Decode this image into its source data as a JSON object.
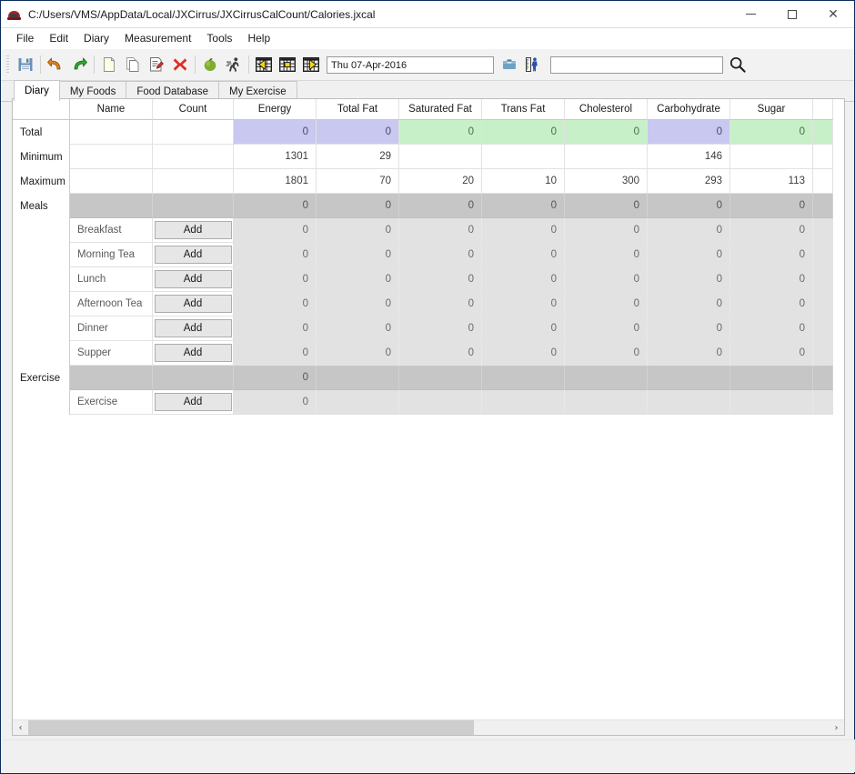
{
  "window": {
    "title": "C:/Users/VMS/AppData/Local/JXCirrus/JXCirrusCalCount/Calories.jxcal",
    "icon": "app-icon",
    "minimize_label": "–",
    "maximize_label": "□",
    "close_label": "✕"
  },
  "menubar": {
    "items": [
      {
        "label": "File"
      },
      {
        "label": "Edit"
      },
      {
        "label": "Diary"
      },
      {
        "label": "Measurement"
      },
      {
        "label": "Tools"
      },
      {
        "label": "Help"
      }
    ]
  },
  "toolbar": {
    "buttons": [
      {
        "name": "save-icon",
        "tip": "Save"
      },
      {
        "name": "undo-icon",
        "tip": "Undo"
      },
      {
        "name": "redo-icon",
        "tip": "Redo"
      },
      {
        "name": "new-document-icon",
        "tip": "New"
      },
      {
        "name": "copy-icon",
        "tip": "Copy"
      },
      {
        "name": "edit-document-icon",
        "tip": "Edit"
      },
      {
        "name": "delete-icon",
        "tip": "Delete"
      },
      {
        "name": "apple-food-icon",
        "tip": "Food"
      },
      {
        "name": "running-person-icon",
        "tip": "Exercise"
      },
      {
        "name": "previous-day-icon",
        "tip": "Previous day"
      },
      {
        "name": "today-icon",
        "tip": "Today"
      },
      {
        "name": "next-day-icon",
        "tip": "Next day"
      }
    ],
    "date_value": "Thu 07-Apr-2016",
    "date_placeholder": "",
    "scale_icon": "weighing-scale-icon",
    "measure_icon": "body-measurement-icon",
    "search_value": "",
    "search_placeholder": "",
    "search_icon": "search-icon"
  },
  "tabs": [
    {
      "label": "Diary",
      "active": true
    },
    {
      "label": "My Foods",
      "active": false
    },
    {
      "label": "Food Database",
      "active": false
    },
    {
      "label": "My Exercise",
      "active": false
    }
  ],
  "grid": {
    "group_header": "",
    "columns": [
      "Name",
      "Count",
      "Energy",
      "Total Fat",
      "Saturated Fat",
      "Trans Fat",
      "Cholesterol",
      "Carbohydrate",
      "Sugar"
    ],
    "rows": [
      {
        "group": "Total",
        "kind": "total",
        "name": "",
        "count": "",
        "values": [
          "0",
          "0",
          "0",
          "0",
          "0",
          "0",
          "0"
        ],
        "highlights": [
          "purple",
          "purple",
          "green",
          "green",
          "green",
          "purple",
          "green"
        ]
      },
      {
        "group": "Minimum",
        "kind": "stat",
        "name": "",
        "count": "",
        "values": [
          "1301",
          "29",
          "",
          "",
          "",
          "146",
          ""
        ],
        "highlights": [
          "plain",
          "plain",
          "plain",
          "plain",
          "plain",
          "plain",
          "plain"
        ]
      },
      {
        "group": "Maximum",
        "kind": "stat",
        "name": "",
        "count": "",
        "values": [
          "1801",
          "70",
          "20",
          "10",
          "300",
          "293",
          "113"
        ],
        "highlights": [
          "plain",
          "plain",
          "plain",
          "plain",
          "plain",
          "plain",
          "plain"
        ]
      },
      {
        "group": "Meals",
        "kind": "group",
        "name": "",
        "count": "",
        "values": [
          "0",
          "0",
          "0",
          "0",
          "0",
          "0",
          "0"
        ],
        "highlights": [
          "plain",
          "plain",
          "plain",
          "plain",
          "plain",
          "plain",
          "plain"
        ]
      },
      {
        "group": "",
        "kind": "sub",
        "name": "Breakfast",
        "count": "Add",
        "values": [
          "0",
          "0",
          "0",
          "0",
          "0",
          "0",
          "0"
        ],
        "highlights": [
          "plain",
          "plain",
          "plain",
          "plain",
          "plain",
          "plain",
          "plain"
        ]
      },
      {
        "group": "",
        "kind": "sub",
        "name": "Morning Tea",
        "count": "Add",
        "values": [
          "0",
          "0",
          "0",
          "0",
          "0",
          "0",
          "0"
        ],
        "highlights": [
          "plain",
          "plain",
          "plain",
          "plain",
          "plain",
          "plain",
          "plain"
        ]
      },
      {
        "group": "",
        "kind": "sub",
        "name": "Lunch",
        "count": "Add",
        "values": [
          "0",
          "0",
          "0",
          "0",
          "0",
          "0",
          "0"
        ],
        "highlights": [
          "plain",
          "plain",
          "plain",
          "plain",
          "plain",
          "plain",
          "plain"
        ]
      },
      {
        "group": "",
        "kind": "sub",
        "name": "Afternoon Tea",
        "count": "Add",
        "values": [
          "0",
          "0",
          "0",
          "0",
          "0",
          "0",
          "0"
        ],
        "highlights": [
          "plain",
          "plain",
          "plain",
          "plain",
          "plain",
          "plain",
          "plain"
        ]
      },
      {
        "group": "",
        "kind": "sub",
        "name": "Dinner",
        "count": "Add",
        "values": [
          "0",
          "0",
          "0",
          "0",
          "0",
          "0",
          "0"
        ],
        "highlights": [
          "plain",
          "plain",
          "plain",
          "plain",
          "plain",
          "plain",
          "plain"
        ]
      },
      {
        "group": "",
        "kind": "sub",
        "name": "Supper",
        "count": "Add",
        "values": [
          "0",
          "0",
          "0",
          "0",
          "0",
          "0",
          "0"
        ],
        "highlights": [
          "plain",
          "plain",
          "plain",
          "plain",
          "plain",
          "plain",
          "plain"
        ]
      },
      {
        "group": "Exercise",
        "kind": "group",
        "name": "",
        "count": "",
        "values": [
          "0",
          "",
          "",
          "",
          "",
          "",
          ""
        ],
        "highlights": [
          "plain",
          "plain",
          "plain",
          "plain",
          "plain",
          "plain",
          "plain"
        ]
      },
      {
        "group": "",
        "kind": "sub",
        "name": "Exercise",
        "count": "Add",
        "values": [
          "0",
          "",
          "",
          "",
          "",
          "",
          ""
        ],
        "highlights": [
          "plain",
          "plain",
          "plain",
          "plain",
          "plain",
          "plain",
          "plain"
        ]
      }
    ],
    "group_labels_vertical": [
      {
        "label": "Total",
        "row": 0
      },
      {
        "label": "Minimum",
        "row": 1
      },
      {
        "label": "Maximum",
        "row": 2
      },
      {
        "label": "Meals",
        "row": 3
      },
      {
        "label": "Exercise",
        "row": 10
      }
    ]
  },
  "scrollbar": {
    "left_arrow": "‹",
    "right_arrow": "›"
  },
  "colors": {
    "purple_highlight": "#c8c8f0",
    "green_highlight": "#c8f0c8",
    "group_row": "#c6c6c6",
    "sub_row": "#e2e2e2",
    "window_border": "#0b2c5a"
  }
}
